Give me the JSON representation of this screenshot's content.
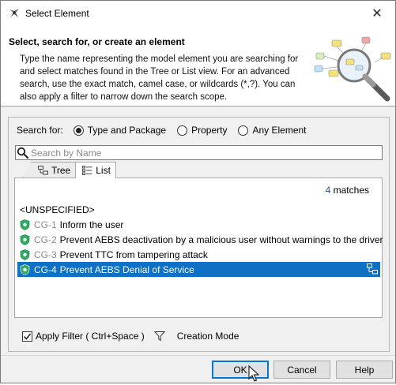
{
  "window": {
    "title": "Select Element",
    "close_glyph": "✕"
  },
  "header": {
    "heading": "Select, search for, or create an element",
    "description": "Type the name representing the model element you are searching for and select matches found in the Tree or List view. For an advanced search, use the exact match, camel case, or wildcards (*,?). You can also apply a filter to narrow down the search scope."
  },
  "search_for": {
    "label": "Search for:",
    "options": [
      {
        "label": "Type and Package",
        "selected": true
      },
      {
        "label": "Property",
        "selected": false
      },
      {
        "label": "Any Element",
        "selected": false
      }
    ]
  },
  "search": {
    "placeholder": "Search by Name",
    "value": ""
  },
  "tabs": [
    {
      "label": "Tree",
      "icon": "tree-icon",
      "active": false
    },
    {
      "label": "List",
      "icon": "list-icon",
      "active": true
    }
  ],
  "results": {
    "count": "4",
    "count_suffix": "matches",
    "rows": [
      {
        "id": "",
        "text": "<UNSPECIFIED>",
        "icon": null,
        "selected": false
      },
      {
        "id": "CG-1",
        "text": "Inform the user",
        "icon": "shield-icon",
        "selected": false
      },
      {
        "id": "CG-2",
        "text": "Prevent AEBS deactivation by a malicious user without warnings to the driver",
        "icon": "shield-icon",
        "selected": false
      },
      {
        "id": "CG-3",
        "text": "Prevent TTC from tampering attack",
        "icon": "shield-icon",
        "selected": false
      },
      {
        "id": "CG-4",
        "text": "Prevent AEBS Denial of Service",
        "icon": "shield-icon",
        "selected": true
      }
    ]
  },
  "filter": {
    "apply_label": "Apply Filter ( Ctrl+Space )",
    "apply_checked": true,
    "creation_mode_label": "Creation Mode"
  },
  "buttons": {
    "ok": "OK",
    "cancel": "Cancel",
    "help": "Help"
  },
  "colors": {
    "selection": "#0f71c4",
    "shield": "#2eaa62",
    "match_count": "#1a4f9a"
  }
}
